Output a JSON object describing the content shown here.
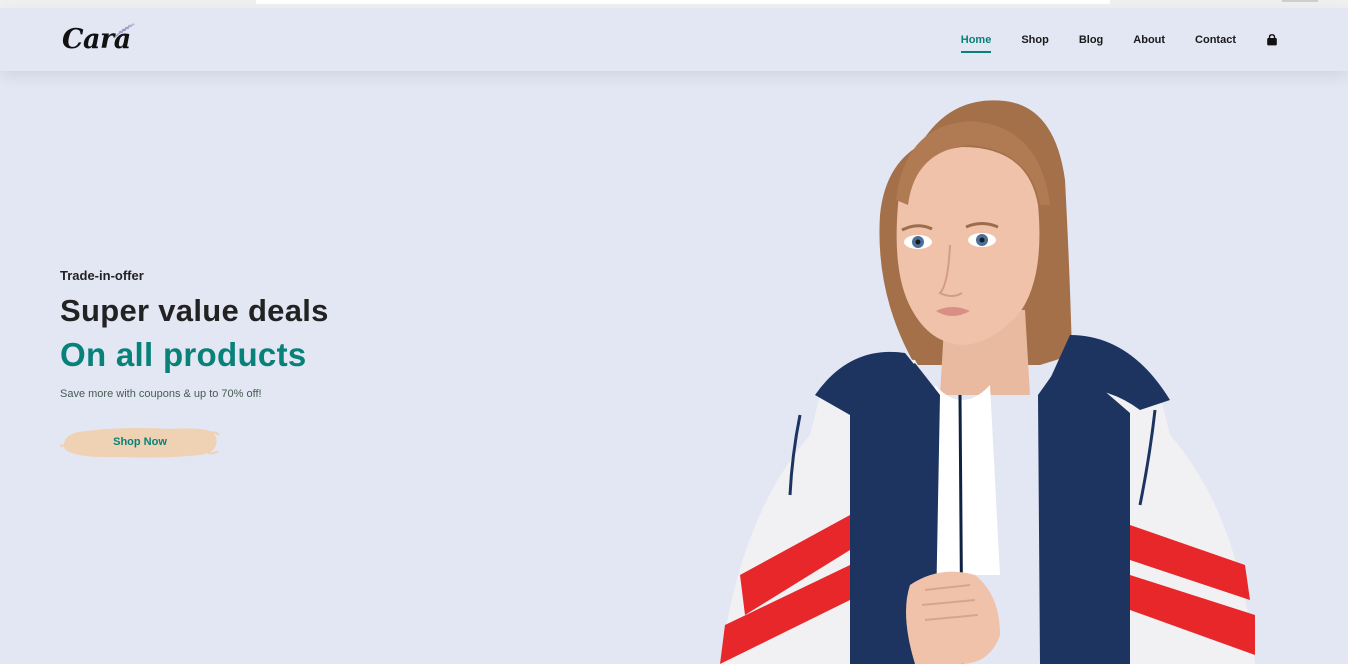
{
  "header": {
    "logo": "Cara",
    "nav": [
      "Home",
      "Shop",
      "Blog",
      "About",
      "Contact"
    ],
    "active": "Home"
  },
  "hero": {
    "subtitle": "Trade-in-offer",
    "title": "Super value deals",
    "highlight": "On all products",
    "description": "Save more with coupons & up to 70% off!",
    "button": "Shop Now"
  },
  "colors": {
    "accent": "#088178",
    "background": "#e3e6f3",
    "button_brush": "#efd2b4"
  },
  "icons": [
    "shopping-bag-icon"
  ]
}
